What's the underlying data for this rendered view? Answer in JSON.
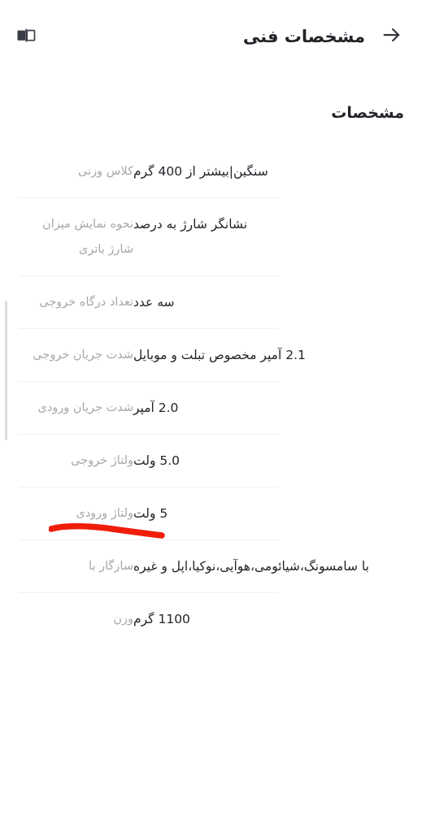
{
  "appbar": {
    "back_icon": "arrow-right-icon",
    "title": "مشخصات فنی",
    "action_icon": "split-panel-icon"
  },
  "content": {
    "section_title": "مشخصات",
    "specs": [
      {
        "label": "کلاس وزنی",
        "value": "سنگین|بیشتر از 400 گرم"
      },
      {
        "label": "نحوه نمایش میزان شارژ باتری",
        "value": "نشانگر شارژ به درصد"
      },
      {
        "label": "تعداد درگاه خروجی",
        "value": "سه عدد"
      },
      {
        "label": "شدت جریان خروجی",
        "value": "2.1 آمپر مخصوص تبلت و موبایل"
      },
      {
        "label": "شدت جریان ورودی",
        "value": "2.0 آمپر"
      },
      {
        "label": "ولتاژ خروجی",
        "value": "5.0 ولت"
      },
      {
        "label": "ولتاژ ورودی",
        "value": "5 ولت"
      },
      {
        "label": "سازگار با",
        "value": "با سامسونگ،شیائومی،هوآیی،نوکیا،اپل و غیره"
      },
      {
        "label": "وزن",
        "value": "1100 گرم"
      }
    ]
  },
  "annotation": {
    "type": "hand-drawn-underline",
    "color": "#ef1d0b"
  },
  "colors": {
    "background": "#ffffff",
    "title_text": "#23242a",
    "label_text": "#a6a8ad",
    "value_text": "#22242a",
    "divider": "#f0f0f1",
    "scrollbar": "#dcdcdd",
    "annotation_red": "#ef1d0b"
  }
}
